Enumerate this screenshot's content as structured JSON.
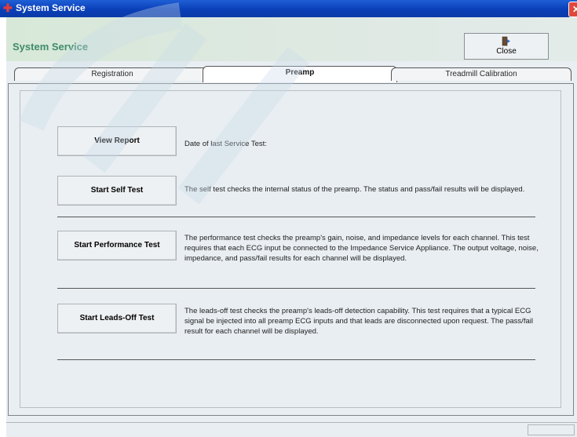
{
  "window": {
    "title": "System Service",
    "close_glyph": "✕"
  },
  "header": {
    "title": "System Service",
    "close_button_label": "Close",
    "close_icon": "exit-door-icon"
  },
  "tabs": [
    {
      "label": "Registration",
      "active": false
    },
    {
      "label": "Preamp",
      "active": true
    },
    {
      "label": "Treadmill Calibration",
      "active": false
    }
  ],
  "actions": [
    {
      "button": "View Report",
      "description": "Date of last Service Test:"
    },
    {
      "button": "Start Self Test",
      "description": "The self test checks the internal status of the preamp. The status and pass/fail results will be displayed."
    },
    {
      "button": "Start Performance Test",
      "description": "The performance test checks the preamp's gain, noise, and impedance levels for each channel. This test requires that each ECG input be connected to the Impedance Service Appliance. The output voltage, noise, impedance, and pass/fail results for each channel will be displayed."
    },
    {
      "button": "Start Leads-Off Test",
      "description": "The leads-off test checks the preamp's leads-off detection capability. This test requires that a typical ECG signal be injected into all preamp ECG inputs and that leads are disconnected upon request. The pass/fail result for each channel will be displayed."
    }
  ],
  "colors": {
    "titlebar": "#0a3fb8",
    "header_text": "#3f8b6a",
    "panel_bg": "#e9eef2"
  }
}
